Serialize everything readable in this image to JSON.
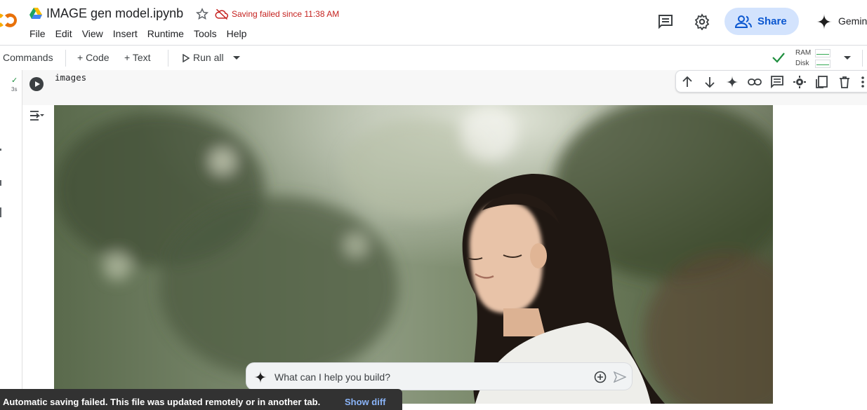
{
  "header": {
    "title": "IMAGE gen model.ipynb",
    "save_status": "Saving failed since 11:38 AM",
    "menu": [
      "File",
      "Edit",
      "View",
      "Insert",
      "Runtime",
      "Tools",
      "Help"
    ],
    "share_label": "Share",
    "gemini_label": "Gemin"
  },
  "toolbar": {
    "commands_label": "Commands",
    "add_code_label": "+ Code",
    "add_text_label": "+ Text",
    "run_all_label": "Run all",
    "ram_label": "RAM",
    "disk_label": "Disk"
  },
  "cell": {
    "code": "images",
    "exec_time": "3s"
  },
  "prompt": {
    "placeholder": "What can I help you build?"
  },
  "toast": {
    "message": "Automatic saving failed. This file was updated remotely or in another tab.",
    "action": "Show diff"
  },
  "colors": {
    "accent_blue": "#0b57d0",
    "share_bg": "#d3e3fd",
    "error_red": "#c5221f",
    "success_green": "#1e8e3e"
  },
  "icons": {
    "header": [
      "drive-icon",
      "star-icon",
      "cloud-off-icon",
      "comment-icon",
      "gear-icon",
      "people-icon",
      "gemini-icon"
    ],
    "cell_toolbar": [
      "arrow-up-icon",
      "arrow-down-icon",
      "gemini-icon",
      "link-icon",
      "comment-icon",
      "gear-icon",
      "mirror-icon",
      "trash-icon",
      "more-icon"
    ]
  }
}
